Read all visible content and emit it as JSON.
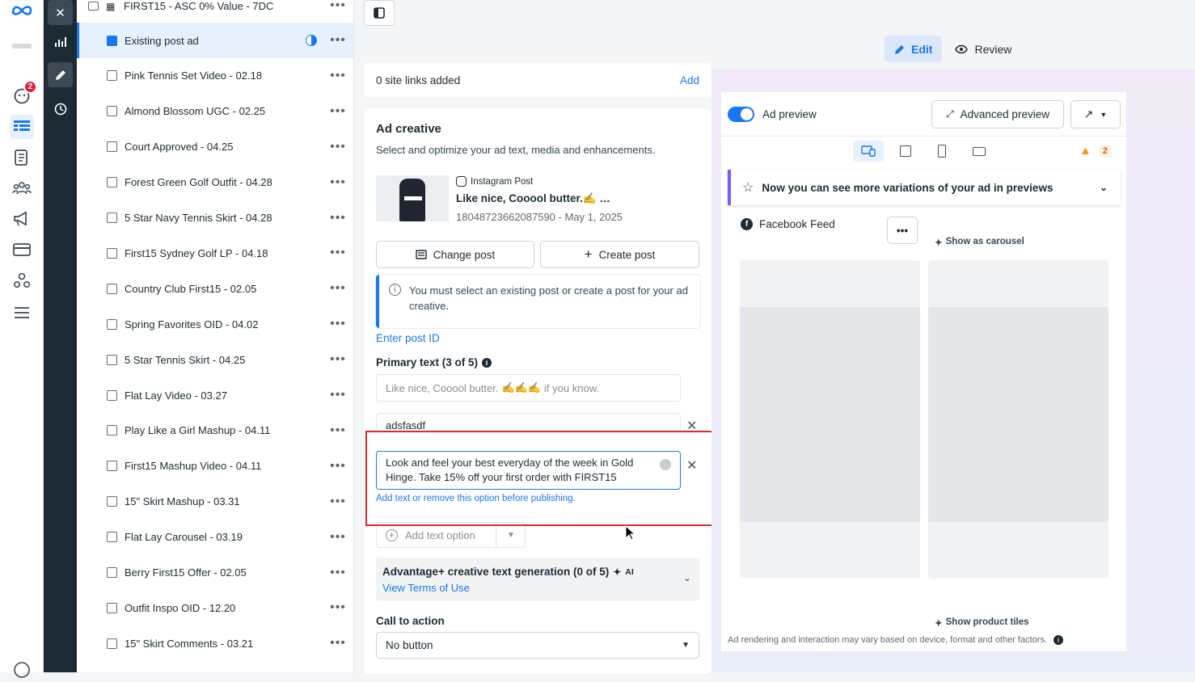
{
  "rail": {
    "icons": [
      "meta-logo-icon",
      "brand-logo-icon",
      "notifications-icon",
      "campaigns-table-icon",
      "pages-icon",
      "audiences-icon",
      "ads-megaphone-icon",
      "billing-card-icon",
      "business-settings-icon",
      "menu-icon",
      "help-icon"
    ],
    "notification_count": "2"
  },
  "toolbar": {
    "icons": [
      "close-icon",
      "chart-icon",
      "pencil-icon",
      "history-icon"
    ]
  },
  "campaigns": {
    "top_item": "FIRST15 - ASC 0% Value - 7DC",
    "items": [
      {
        "name": "Existing post ad",
        "selected": true
      },
      {
        "name": "Pink Tennis Set Video - 02.18"
      },
      {
        "name": "Almond Blossom UGC - 02.25"
      },
      {
        "name": "Court Approved - 04.25"
      },
      {
        "name": "Forest Green Golf Outfit - 04.28"
      },
      {
        "name": "5 Star Navy Tennis Skirt - 04.28"
      },
      {
        "name": "First15 Sydney Golf LP - 04.18"
      },
      {
        "name": "Country Club First15 - 02.05"
      },
      {
        "name": "Spring Favorites OID - 04.02"
      },
      {
        "name": "5 Star Tennis Skirt - 04.25"
      },
      {
        "name": "Flat Lay Video - 03.27"
      },
      {
        "name": "Play Like a Girl Mashup - 04.11"
      },
      {
        "name": "First15 Mashup Video - 04.11"
      },
      {
        "name": "15\" Skirt Mashup - 03.31"
      },
      {
        "name": "Flat Lay Carousel - 03.19"
      },
      {
        "name": "Berry First15 Offer - 02.05"
      },
      {
        "name": "Outfit Inspo OID - 12.20"
      },
      {
        "name": "15\" Skirt Comments - 03.21"
      }
    ],
    "more": "•••"
  },
  "tabs": {
    "edit": "Edit",
    "review": "Review"
  },
  "site_links": {
    "count_text": "0 site links added",
    "add": "Add"
  },
  "ad_creative": {
    "title": "Ad creative",
    "subtitle": "Select and optimize your ad text, media and enhancements.",
    "post_source": "Instagram Post",
    "post_title": "Like nice, Cooool butter.",
    "post_meta": "18048723662087590 - May 1, 2025",
    "change_post": "Change post",
    "create_post": "Create post",
    "info": "You must select an existing post or create a post for your ad creative.",
    "enter_post_id": "Enter post ID",
    "primary_text_label": "Primary text (3 of 5)",
    "text_option_1": "Like nice, Cooool butter.",
    "text_option_1_tail": "if you know.",
    "text_option_2": "adsfasdf",
    "text_option_3": "Look and feel your best everyday of the week in Gold Hinge. Take 15% off your first order with FIRST15",
    "helper": "Add text or remove this option before publishing.",
    "add_text_option": "Add text option",
    "advantage_title": "Advantage+ creative text generation (0 of 5)",
    "ai_tag": "AI",
    "terms": "View Terms of Use",
    "cta_label": "Call to action",
    "cta_value": "No button"
  },
  "preview": {
    "ad_preview": "Ad preview",
    "advanced": "Advanced preview",
    "warning_count": "2",
    "notice": "Now you can see more variations of your ad in previews",
    "placement": "Facebook Feed",
    "carousel": "Show as carousel",
    "product_tiles": "Show product tiles",
    "footer": "Ad rendering and interaction may vary based on device, format and other factors.",
    "more": "•••"
  },
  "colors": {
    "accent": "#1877f2",
    "highlight": "#e0262b",
    "notice_bar": "#7a5af8",
    "warning": "#f7931e"
  }
}
